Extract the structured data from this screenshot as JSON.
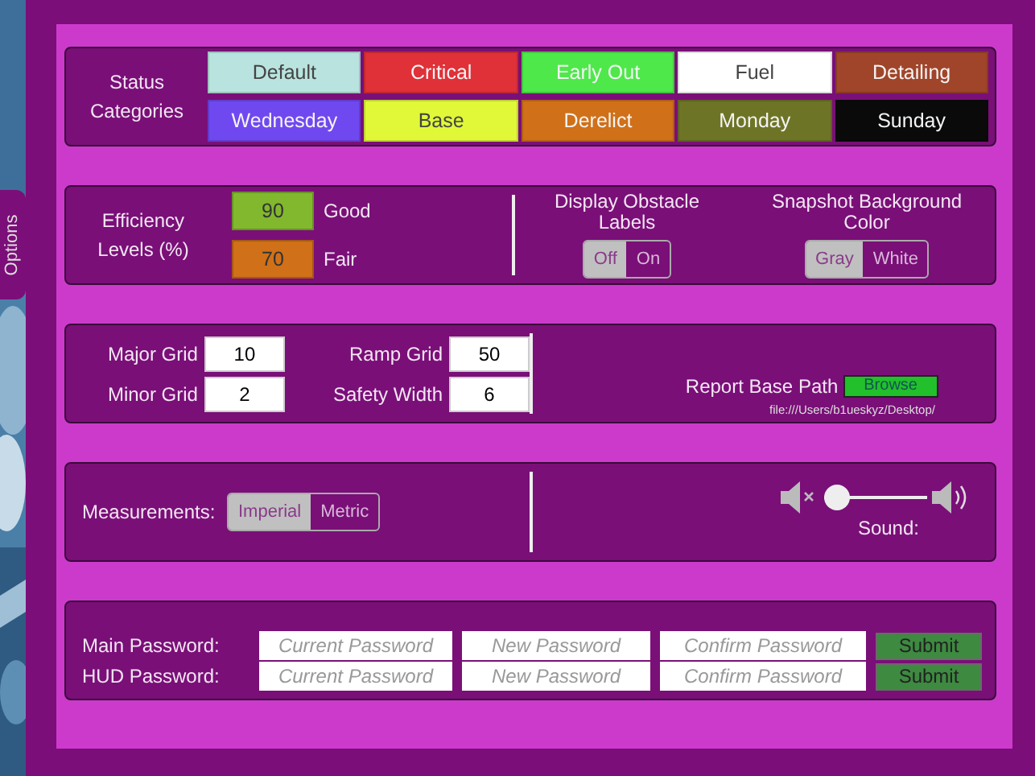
{
  "side_tab": {
    "label": "Options"
  },
  "status_categories": {
    "label": "Status Categories",
    "items": [
      {
        "label": "Default",
        "color": "#b9e3df"
      },
      {
        "label": "Critical",
        "color": "#e03038"
      },
      {
        "label": "Early Out",
        "color": "#4ee84a"
      },
      {
        "label": "Fuel",
        "color": "#ffffff"
      },
      {
        "label": "Detailing",
        "color": "#a0452a"
      },
      {
        "label": "Wednesday",
        "color": "#7048f0"
      },
      {
        "label": "Base",
        "color": "#e0f838"
      },
      {
        "label": "Derelict",
        "color": "#d07018"
      },
      {
        "label": "Monday",
        "color": "#6e7426"
      },
      {
        "label": "Sunday",
        "color": "#0a0a0a"
      }
    ]
  },
  "efficiency": {
    "label": "Efficiency Levels (%)",
    "levels": [
      {
        "value": "90",
        "label": "Good",
        "color": "#82b82e"
      },
      {
        "value": "70",
        "label": "Fair",
        "color": "#d07018"
      }
    ]
  },
  "toggles": [
    {
      "title": "Display Obstacle Labels",
      "options": [
        {
          "label": "Off",
          "selected": true
        },
        {
          "label": "On",
          "selected": false
        }
      ]
    },
    {
      "title": "Snapshot Background Color",
      "options": [
        {
          "label": "Gray",
          "selected": true
        },
        {
          "label": "White",
          "selected": false
        }
      ]
    }
  ],
  "grid_fields": [
    {
      "label": "Major Grid",
      "value": "10"
    },
    {
      "label": "Ramp Grid",
      "value": "50"
    },
    {
      "label": "Minor Grid",
      "value": "2"
    },
    {
      "label": "Safety Width",
      "value": "6"
    }
  ],
  "report": {
    "label": "Report Base Path",
    "button": "Browse",
    "path": "file:///Users/b1ueskyz/Desktop/"
  },
  "measurements": {
    "label": "Measurements:",
    "options": [
      {
        "label": "Imperial",
        "selected": true
      },
      {
        "label": "Metric",
        "selected": false
      }
    ]
  },
  "sound": {
    "label": "Sound:",
    "level": 0
  },
  "passwords": [
    {
      "label": "Main Password:",
      "placeholders": [
        "Current Password",
        "New Password",
        "Confirm Password"
      ],
      "button": "Submit"
    },
    {
      "label": "HUD Password:",
      "placeholders": [
        "Current Password",
        "New Password",
        "Confirm Password"
      ],
      "button": "Submit"
    }
  ]
}
